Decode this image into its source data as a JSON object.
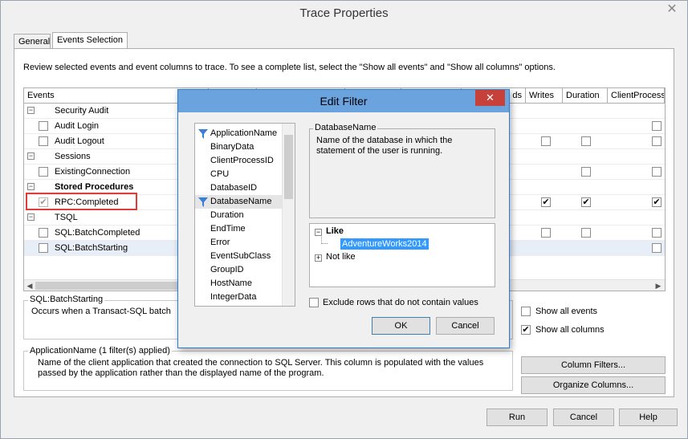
{
  "window": {
    "title": "Trace Properties",
    "close_glyph": "✕"
  },
  "tabs": [
    {
      "label": "General"
    },
    {
      "label": "Events Selection"
    }
  ],
  "intro_text": "Review selected events and event columns to trace. To see a complete list, select the \"Show all events\" and \"Show all columns\" options.",
  "grid": {
    "headers": {
      "events": "Events",
      "reads_partial": "ds",
      "writes": "Writes",
      "duration": "Duration",
      "clientprocess": "ClientProcess"
    },
    "rows": [
      {
        "kind": "category",
        "label": "Security Audit",
        "expander": "−"
      },
      {
        "kind": "event",
        "label": "Audit Login",
        "checked": false,
        "cells": [
          "",
          "",
          "",
          "☐"
        ]
      },
      {
        "kind": "event",
        "label": "Audit Logout",
        "checked": false,
        "cells": [
          "",
          "☐",
          "☐",
          "☐"
        ]
      },
      {
        "kind": "category",
        "label": "Sessions",
        "expander": "−"
      },
      {
        "kind": "event",
        "label": "ExistingConnection",
        "checked": false,
        "cells": [
          "",
          "",
          "☐",
          "☐"
        ]
      },
      {
        "kind": "category",
        "label": "Stored Procedures",
        "expander": "−",
        "bold": true
      },
      {
        "kind": "event",
        "label": "RPC:Completed",
        "checked": true,
        "disabled": true,
        "cells": [
          "",
          "☑",
          "☑",
          "☑"
        ]
      },
      {
        "kind": "category",
        "label": "TSQL",
        "expander": "−"
      },
      {
        "kind": "event",
        "label": "SQL:BatchCompleted",
        "checked": false,
        "cells": [
          "",
          "☐",
          "☐",
          "☐"
        ]
      },
      {
        "kind": "event",
        "label": "SQL:BatchStarting",
        "checked": false,
        "cells": [
          "",
          "",
          "",
          "☐"
        ]
      }
    ],
    "scroll_left": "◀",
    "scroll_right": "▶"
  },
  "event_group": {
    "title": "SQL:BatchStarting",
    "text": "Occurs when a Transact-SQL batch"
  },
  "column_group": {
    "title": "ApplicationName (1 filter(s) applied)",
    "text": "Name of the client application that created the connection to SQL Server. This column is populated with the values passed by the application rather than the displayed name of the program."
  },
  "options": {
    "show_all_events": {
      "label": "Show all events",
      "checked": false
    },
    "show_all_columns": {
      "label": "Show all columns",
      "checked": true
    }
  },
  "buttons": {
    "column_filters": "Column Filters...",
    "organize_columns": "Organize Columns...",
    "run": "Run",
    "cancel": "Cancel",
    "help": "Help"
  },
  "edit_filter": {
    "title": "Edit Filter",
    "close_glyph": "✕",
    "columns": [
      {
        "label": "ApplicationName",
        "filtered": true
      },
      {
        "label": "BinaryData",
        "filtered": false
      },
      {
        "label": "ClientProcessID",
        "filtered": false
      },
      {
        "label": "CPU",
        "filtered": false
      },
      {
        "label": "DatabaseID",
        "filtered": false
      },
      {
        "label": "DatabaseName",
        "filtered": true,
        "current": true
      },
      {
        "label": "Duration",
        "filtered": false
      },
      {
        "label": "EndTime",
        "filtered": false
      },
      {
        "label": "Error",
        "filtered": false
      },
      {
        "label": "EventSubClass",
        "filtered": false
      },
      {
        "label": "GroupID",
        "filtered": false
      },
      {
        "label": "HostName",
        "filtered": false
      },
      {
        "label": "IntegerData",
        "filtered": false
      }
    ],
    "description_title": "DatabaseName",
    "description_text": "Name of the database in which the statement of the user is running.",
    "tree": {
      "like_label": "Like",
      "like_expander": "−",
      "like_value": "AdventureWorks2014",
      "notlike_label": "Not like",
      "notlike_expander": "+"
    },
    "exclude_label": "Exclude rows that do not contain values",
    "exclude_checked": false,
    "ok_label": "OK",
    "cancel_label": "Cancel"
  },
  "colors": {
    "accent": "#2c7bd8",
    "dialog_titlebar": "#6ba3df",
    "close_red": "#c7413b",
    "highlight": "#3399ff",
    "annotation_box": "#e03c3c"
  }
}
